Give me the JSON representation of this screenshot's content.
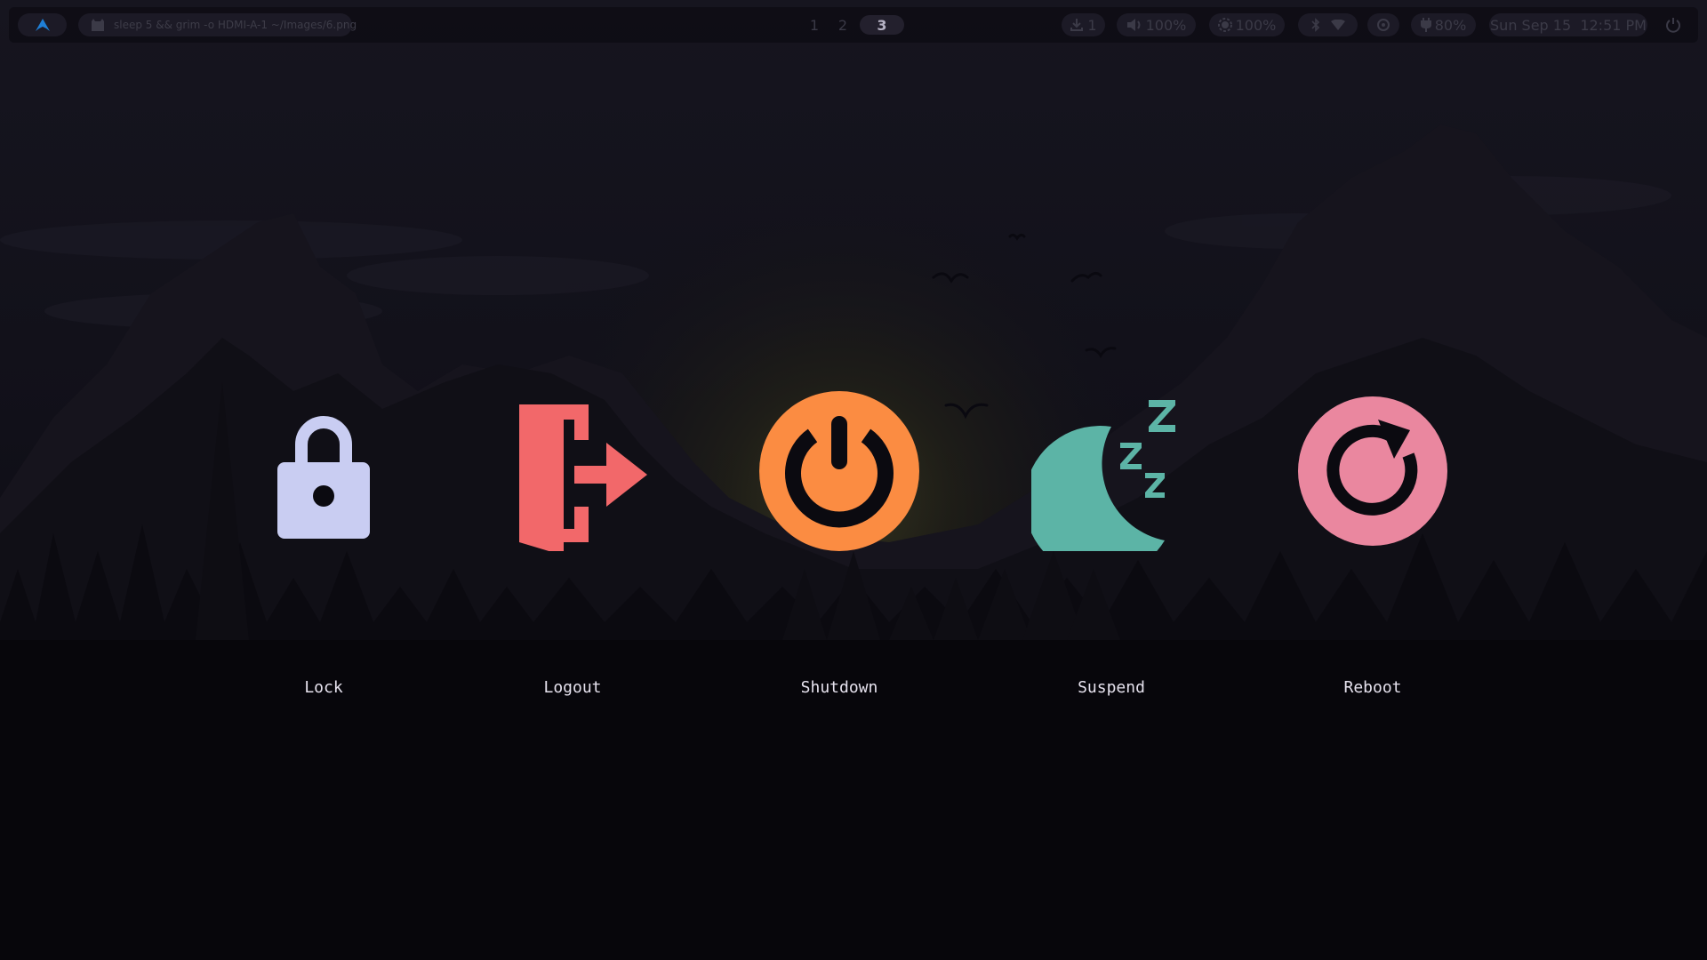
{
  "topbar": {
    "launcher_icon": "arch-logo-icon",
    "active_window": {
      "icon": "terminal-cat-icon",
      "title": "sleep 5 && grim -o HDMI-A-1 ~/Images/6.png"
    },
    "workspaces": [
      {
        "label": "1",
        "active": false
      },
      {
        "label": "2",
        "active": false
      },
      {
        "label": "3",
        "active": true
      }
    ],
    "updates": {
      "icon": "download-icon",
      "count": "1"
    },
    "volume": {
      "icon": "speaker-icon",
      "value": "100%"
    },
    "brightness": {
      "icon": "brightness-icon",
      "value": "100%"
    },
    "bluetooth_icon": "bluetooth-icon",
    "wifi_icon": "wifi-icon",
    "idle_icon": "idle-inhibitor-icon",
    "battery": {
      "icon": "power-plug-icon",
      "value": "80%"
    },
    "clock": "Sun Sep 15  12:51 PM",
    "power_icon": "power-icon"
  },
  "power_menu": {
    "options": [
      {
        "id": "lock",
        "label": "Lock",
        "icon": "lock-icon",
        "color": "#c9cdf2"
      },
      {
        "id": "logout",
        "label": "Logout",
        "icon": "logout-icon",
        "color": "#f2686a"
      },
      {
        "id": "shutdown",
        "label": "Shutdown",
        "icon": "power-icon",
        "color": "#fb8c42"
      },
      {
        "id": "suspend",
        "label": "Suspend",
        "icon": "moon-sleep-icon",
        "color": "#5cb4a6"
      },
      {
        "id": "reboot",
        "label": "Reboot",
        "icon": "reboot-icon",
        "color": "#ea879f"
      }
    ]
  },
  "colors": {
    "background": "#06050a",
    "bar_text": "#3b3a47",
    "label_text": "#e6e2ee",
    "sun_glow": "#2b2b1c"
  }
}
